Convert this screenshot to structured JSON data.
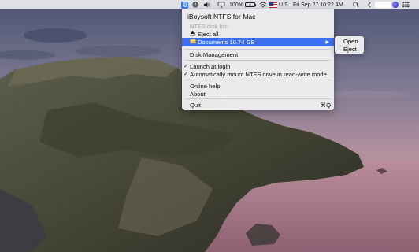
{
  "menubar": {
    "battery_percent": "100%",
    "input_source": "U.S.",
    "clock": "Fri Sep 27  10:22 AM"
  },
  "app_menu": {
    "title": "iBoysoft NTFS for Mac",
    "disk_list_header": "NTFS disk list:",
    "eject_all": "Eject all",
    "selected_disk": "Documents  10.74 GB",
    "disk_management": "Disk Management",
    "launch_at_login": "Launch at login",
    "auto_mount": "Automatically mount NTFS drive in read-write mode",
    "online_help": "Online help",
    "about": "About",
    "quit": "Quit",
    "quit_shortcut": "⌘Q"
  },
  "submenu": {
    "open": "Open",
    "eject": "Eject"
  },
  "colors": {
    "menu_highlight": "#3d6ff2",
    "app_icon": "#3478f6"
  },
  "icons": [
    "iboysoft-app-icon",
    "globe-icon",
    "volume-icon",
    "screen-mirroring-icon",
    "battery-icon",
    "us-flag-icon",
    "wifi-icon",
    "search-icon",
    "chevron-left-icon",
    "siri-icon",
    "notification-center-icon",
    "eject-icon",
    "disk-icon",
    "checkmark-icon",
    "submenu-arrow-icon"
  ]
}
